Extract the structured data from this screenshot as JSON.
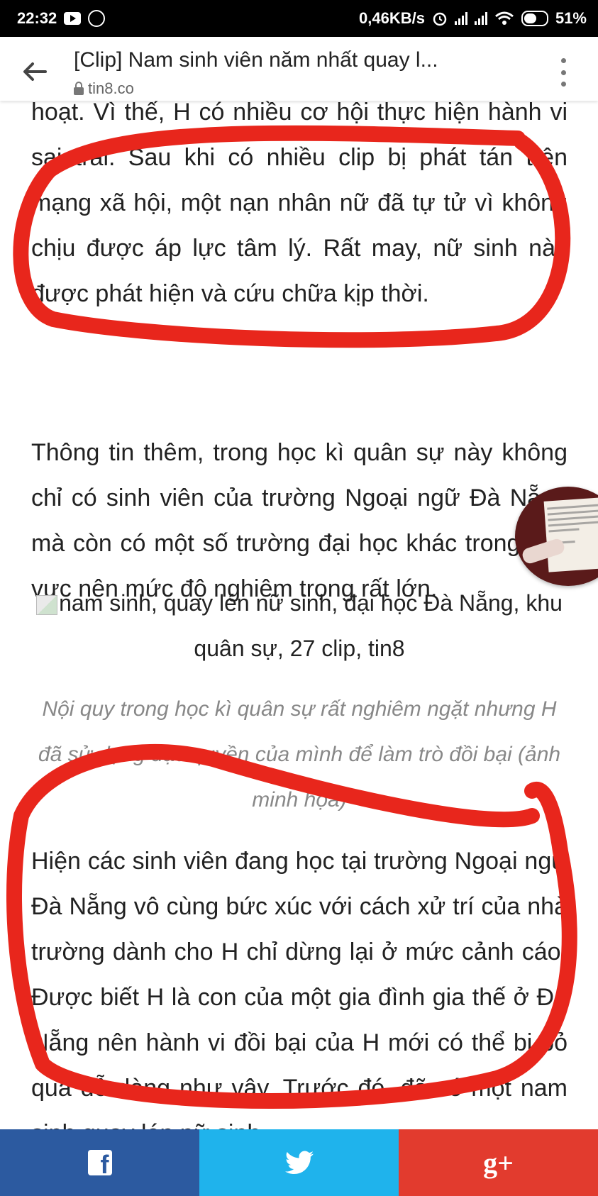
{
  "status_bar": {
    "time": "22:32",
    "speed": "0,46KB/s",
    "battery": "51%",
    "icons": [
      "play-icon",
      "messenger-icon",
      "alarm-icon",
      "signal-icon",
      "wifi-icon",
      "battery-icon"
    ]
  },
  "app_bar": {
    "title": "[Clip] Nam sinh viên năm nhất quay l...",
    "domain": "tin8.co",
    "icons": [
      "back-arrow-icon",
      "lock-icon",
      "more-vert-icon"
    ]
  },
  "article": {
    "paragraphs": [
      "hoạt. Vì thế, H có nhiều cơ hội thực hiện hành vi sai trái. Sau khi có nhiều clip bị phát tán trên mạng xã hội, một nạn nhân nữ đã tự tử vì không chịu được áp lực tâm lý. Rất may, nữ sinh này được phát hiện và cứu chữa kịp thời.",
      "Thông tin thêm, trong học kì quân sự này không chỉ có sinh viên của trường Ngoại ngữ Đà Nẵng mà còn có một số trường đại học khác trong khu vực nên mức độ nghiêm trọng rất lớn.",
      "Hiện các sinh viên đang học tại trường Ngoại ngữ Đà Nẵng vô cùng bức xúc với cách xử trí của nhà trường dành cho H chỉ dừng lại ở mức cảnh cáo. Được biết H là con của một gia đình gia thế ở Đà Nẵng nên hành vi đồi bại của H mới có thể bị bỏ qua dễ dàng như vậy. Trước đó, đã có một nam sinh quay lén nữ sinh"
    ],
    "image_alt": "nam sinh, quay lén nữ sinh, đại học Đà Nẵng, khu quân sự, 27 clip, tin8",
    "caption": "Nội quy trong học kì quân sự rất nghiêm ngặt nhưng H đã sử dụng đặc quyền của mình để làm trò đồi bại (ảnh minh họa)"
  },
  "colors": {
    "annotation_red": "#e8261c",
    "facebook": "#2c5aa0",
    "twitter": "#1fb3ec",
    "googleplus": "#e23b2e"
  },
  "share_bar": {
    "icons": [
      "facebook-icon",
      "twitter-icon",
      "google-plus-icon"
    ],
    "gplus_label": "g+"
  }
}
